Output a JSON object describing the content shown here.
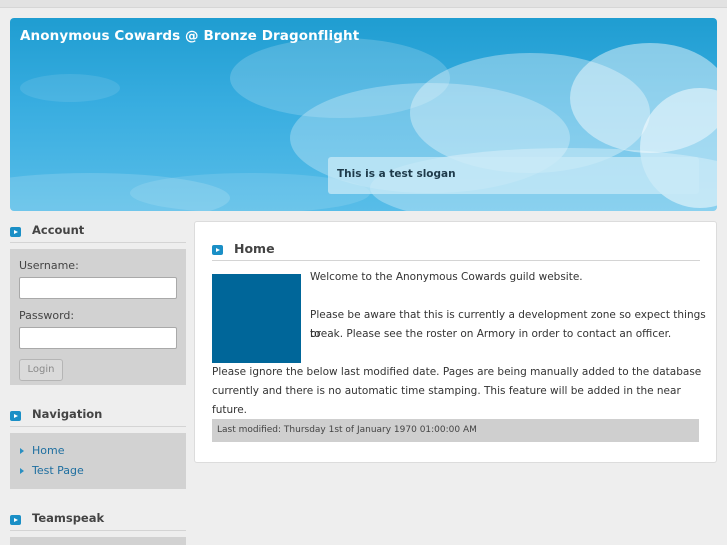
{
  "header": {
    "site_title": "Anonymous Cowards @ Bronze Dragonflight",
    "slogan": "This is a test slogan"
  },
  "sidebar": {
    "account": {
      "title": "Account",
      "username_label": "Username:",
      "password_label": "Password:",
      "login_label": "Login"
    },
    "navigation": {
      "title": "Navigation",
      "items": [
        {
          "label": "Home"
        },
        {
          "label": "Test Page"
        }
      ]
    },
    "teamspeak": {
      "title": "Teamspeak"
    }
  },
  "main": {
    "title": "Home",
    "paragraphs": [
      "Welcome to the Anonymous Cowards guild website.",
      "Please be aware that this is currently a development zone so expect things to",
      "break. Please see the roster on Armory in order to contact an officer.",
      "Please ignore the below last modified date. Pages are being manually added to the database",
      "currently and there is no automatic time stamping. This feature will be added in the near future."
    ],
    "last_modified": "Last modified: Thursday 1st of January 1970 01:00:00 AM"
  },
  "colors": {
    "header_blue": "#2ba4d9",
    "image_placeholder": "#006699",
    "link": "#1f6fa0",
    "bullet": "#1a8fc6"
  }
}
